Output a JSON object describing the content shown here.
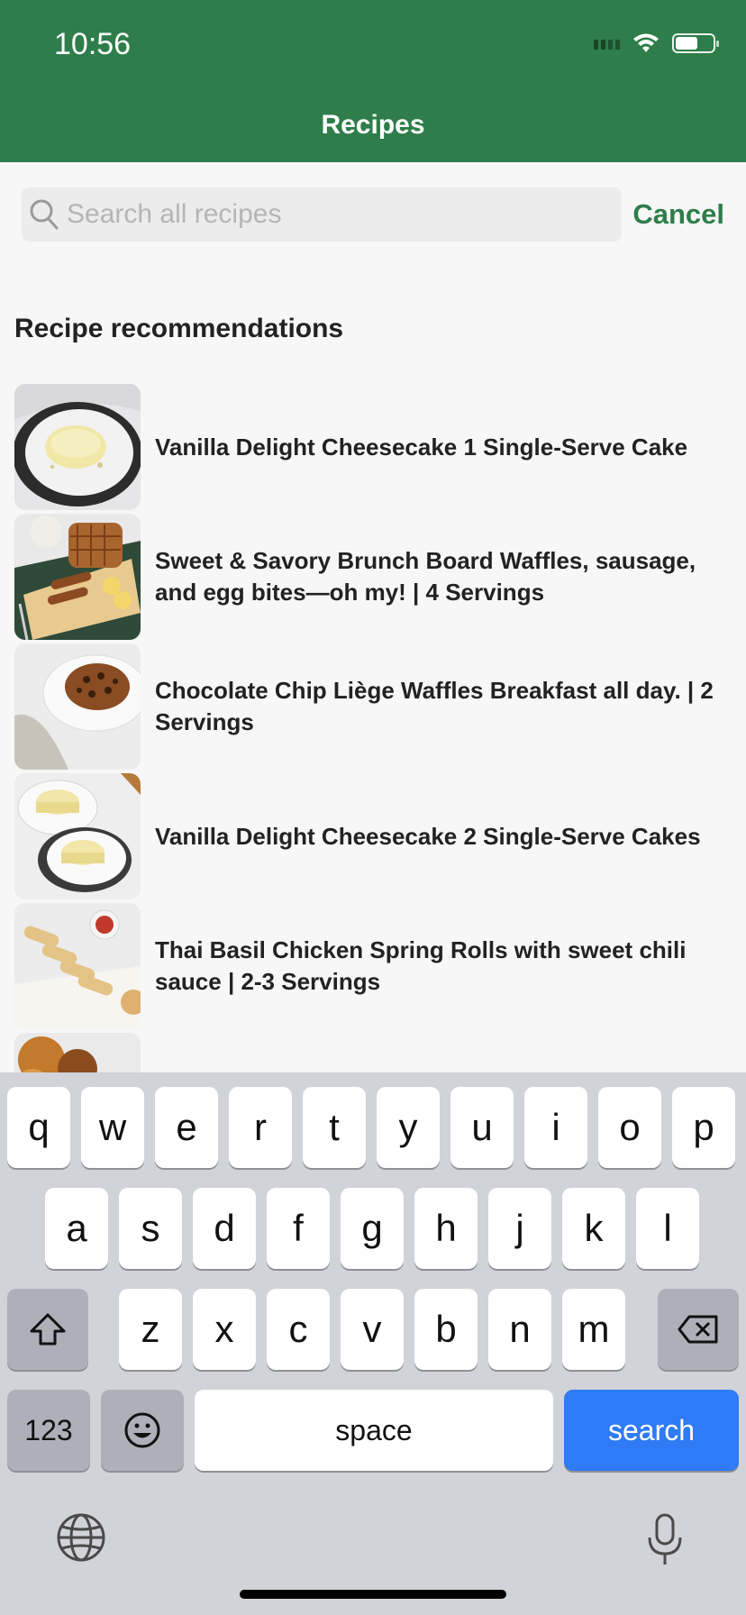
{
  "status_bar": {
    "time": "10:56"
  },
  "header": {
    "title": "Recipes"
  },
  "search": {
    "placeholder": "Search all recipes",
    "value": "",
    "cancel_label": "Cancel"
  },
  "section": {
    "title": "Recipe recommendations"
  },
  "recipes": [
    {
      "title": "Vanilla Delight Cheesecake 1 Single-Serve Cake"
    },
    {
      "title": "Sweet & Savory Brunch Board Waffles, sausage, and egg bites—oh my! | 4 Servings"
    },
    {
      "title": "Chocolate Chip Liège Waffles Breakfast all day. | 2 Servings"
    },
    {
      "title": "Vanilla Delight Cheesecake 2 Single-Serve Cakes"
    },
    {
      "title": "Thai Basil Chicken Spring Rolls with sweet chili sauce | 2-3 Servings"
    }
  ],
  "keyboard": {
    "row1": [
      "q",
      "w",
      "e",
      "r",
      "t",
      "y",
      "u",
      "i",
      "o",
      "p"
    ],
    "row2": [
      "a",
      "s",
      "d",
      "f",
      "g",
      "h",
      "j",
      "k",
      "l"
    ],
    "row3": [
      "z",
      "x",
      "c",
      "v",
      "b",
      "n",
      "m"
    ],
    "numbers_label": "123",
    "space_label": "space",
    "search_label": "search"
  },
  "colors": {
    "brand": "#2e7d4a",
    "search_key": "#2f7bf5"
  }
}
